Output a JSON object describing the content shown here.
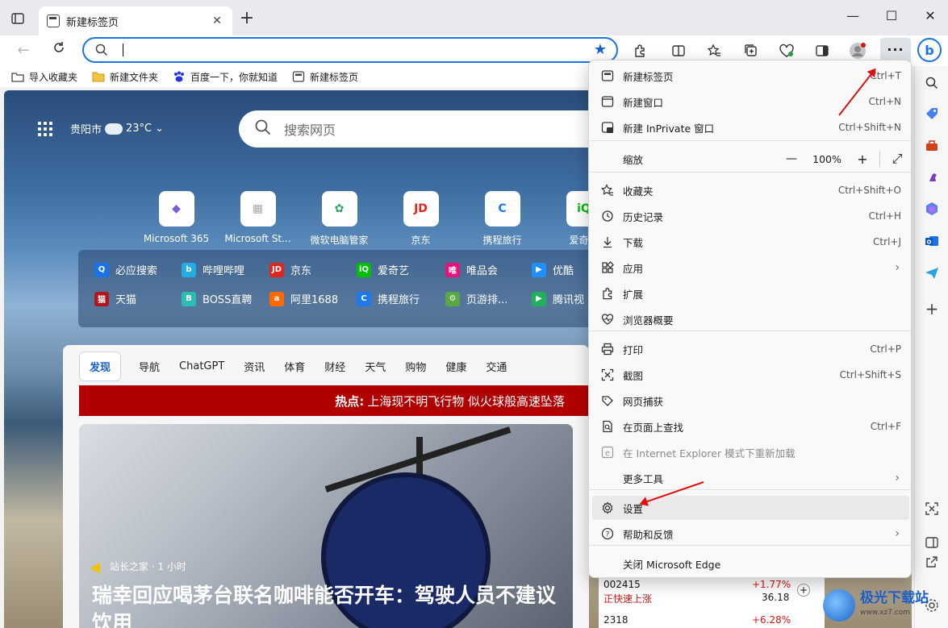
{
  "tab": {
    "title": "新建标签页",
    "close": "✕"
  },
  "window": {
    "minimize": "—",
    "maximize": "☐",
    "close": "✕"
  },
  "favorites": [
    {
      "label": "导入收藏夹"
    },
    {
      "label": "新建文件夹"
    },
    {
      "label": "百度一下，你就知道"
    },
    {
      "label": "新建标签页"
    }
  ],
  "weather": {
    "city": "贵阳市",
    "temp": "23°C"
  },
  "search": {
    "placeholder": "搜索网页"
  },
  "tiles": [
    {
      "label": "Microsoft 365",
      "icon": "m365-icon",
      "color": "#7b5cd6",
      "glyph": "◆"
    },
    {
      "label": "Microsoft St...",
      "icon": "store-icon",
      "color": "#aaaaaa",
      "glyph": "▦"
    },
    {
      "label": "微软电脑管家",
      "icon": "pcmanager-icon",
      "color": "#2e9e6b",
      "glyph": "✿"
    },
    {
      "label": "京东",
      "icon": "jd-icon",
      "color": "#e1251b",
      "glyph": "JD"
    },
    {
      "label": "携程旅行",
      "icon": "ctrip-icon",
      "color": "#1d7ae8",
      "glyph": "C"
    },
    {
      "label": "爱奇艺",
      "icon": "iqiyi-icon",
      "color": "#00be06",
      "glyph": "iQ"
    }
  ],
  "quicklinks": [
    {
      "label": "必应搜索",
      "color": "#1a73e8",
      "glyph": "Q"
    },
    {
      "label": "哔哩哔哩",
      "color": "#23ade5",
      "glyph": "b"
    },
    {
      "label": "京东",
      "color": "#e1251b",
      "glyph": "JD"
    },
    {
      "label": "爱奇艺",
      "color": "#00be06",
      "glyph": "iQ"
    },
    {
      "label": "唯品会",
      "color": "#e5137c",
      "glyph": "唯"
    },
    {
      "label": "优酷",
      "color": "#1e90ff",
      "glyph": "▶"
    },
    {
      "label": "天猫",
      "color": "#b0161c",
      "glyph": "猫"
    },
    {
      "label": "BOSS直聘",
      "color": "#2bbdb3",
      "glyph": "B"
    },
    {
      "label": "阿里1688",
      "color": "#ff6a00",
      "glyph": "a"
    },
    {
      "label": "携程旅行",
      "color": "#1d7ae8",
      "glyph": "C"
    },
    {
      "label": "页游排...",
      "color": "#58a845",
      "glyph": "⚙"
    },
    {
      "label": "腾讯视",
      "color": "#1fb25a",
      "glyph": "▶"
    }
  ],
  "feed": {
    "tabs": [
      "发现",
      "导航",
      "ChatGPT",
      "资讯",
      "体育",
      "财经",
      "天气",
      "购物",
      "健康",
      "交通"
    ],
    "hot_label": "热点:",
    "hot_text": "上海现不明飞行物 似火球般高速坠落",
    "article_source": "站长之家 · 1 小时",
    "article_headline": "瑞幸回应喝茅台联名咖啡能否开车：驾驶人员不建议饮用"
  },
  "stocks": [
    {
      "code": "002415",
      "name": "正快速上涨",
      "change": "+1.77%",
      "price": "36.18"
    },
    {
      "code": "2318",
      "change": "+6.28%"
    }
  ],
  "menu": {
    "items": [
      {
        "label": "新建标签页",
        "shortcut": "Ctrl+T",
        "icon": "new-tab-icon"
      },
      {
        "label": "新建窗口",
        "shortcut": "Ctrl+N",
        "icon": "new-window-icon"
      },
      {
        "label": "新建 InPrivate 窗口",
        "shortcut": "Ctrl+Shift+N",
        "icon": "inprivate-icon"
      },
      {
        "label": "缩放",
        "icon": "zoom-icon"
      },
      {
        "label": "收藏夹",
        "shortcut": "Ctrl+Shift+O",
        "icon": "favorites-icon"
      },
      {
        "label": "历史记录",
        "shortcut": "Ctrl+H",
        "icon": "history-icon"
      },
      {
        "label": "下载",
        "shortcut": "Ctrl+J",
        "icon": "download-icon"
      },
      {
        "label": "应用",
        "icon": "apps-icon"
      },
      {
        "label": "扩展",
        "icon": "extensions-icon"
      },
      {
        "label": "浏览器概要",
        "icon": "browser-essentials-icon"
      },
      {
        "label": "打印",
        "shortcut": "Ctrl+P",
        "icon": "print-icon"
      },
      {
        "label": "截图",
        "shortcut": "Ctrl+Shift+S",
        "icon": "screenshot-icon"
      },
      {
        "label": "网页捕获",
        "icon": "web-capture-icon"
      },
      {
        "label": "在页面上查找",
        "shortcut": "Ctrl+F",
        "icon": "find-icon"
      },
      {
        "label": "在 Internet Explorer 模式下重新加载",
        "icon": "ie-mode-icon"
      },
      {
        "label": "更多工具",
        "icon": "more-tools-icon"
      },
      {
        "label": "设置",
        "icon": "settings-icon"
      },
      {
        "label": "帮助和反馈",
        "icon": "help-icon"
      },
      {
        "label": "关闭 Microsoft Edge",
        "icon": "close-edge-icon"
      }
    ],
    "zoom": {
      "minus": "—",
      "value": "100%",
      "plus": "+",
      "fullscreen": "⤢"
    }
  },
  "watermark": {
    "title": "极光下载站",
    "url": "www.xz7.com"
  },
  "colors": {
    "accent": "#1a73e8",
    "annotation": "#e01010",
    "hot_banner": "#b10000"
  }
}
